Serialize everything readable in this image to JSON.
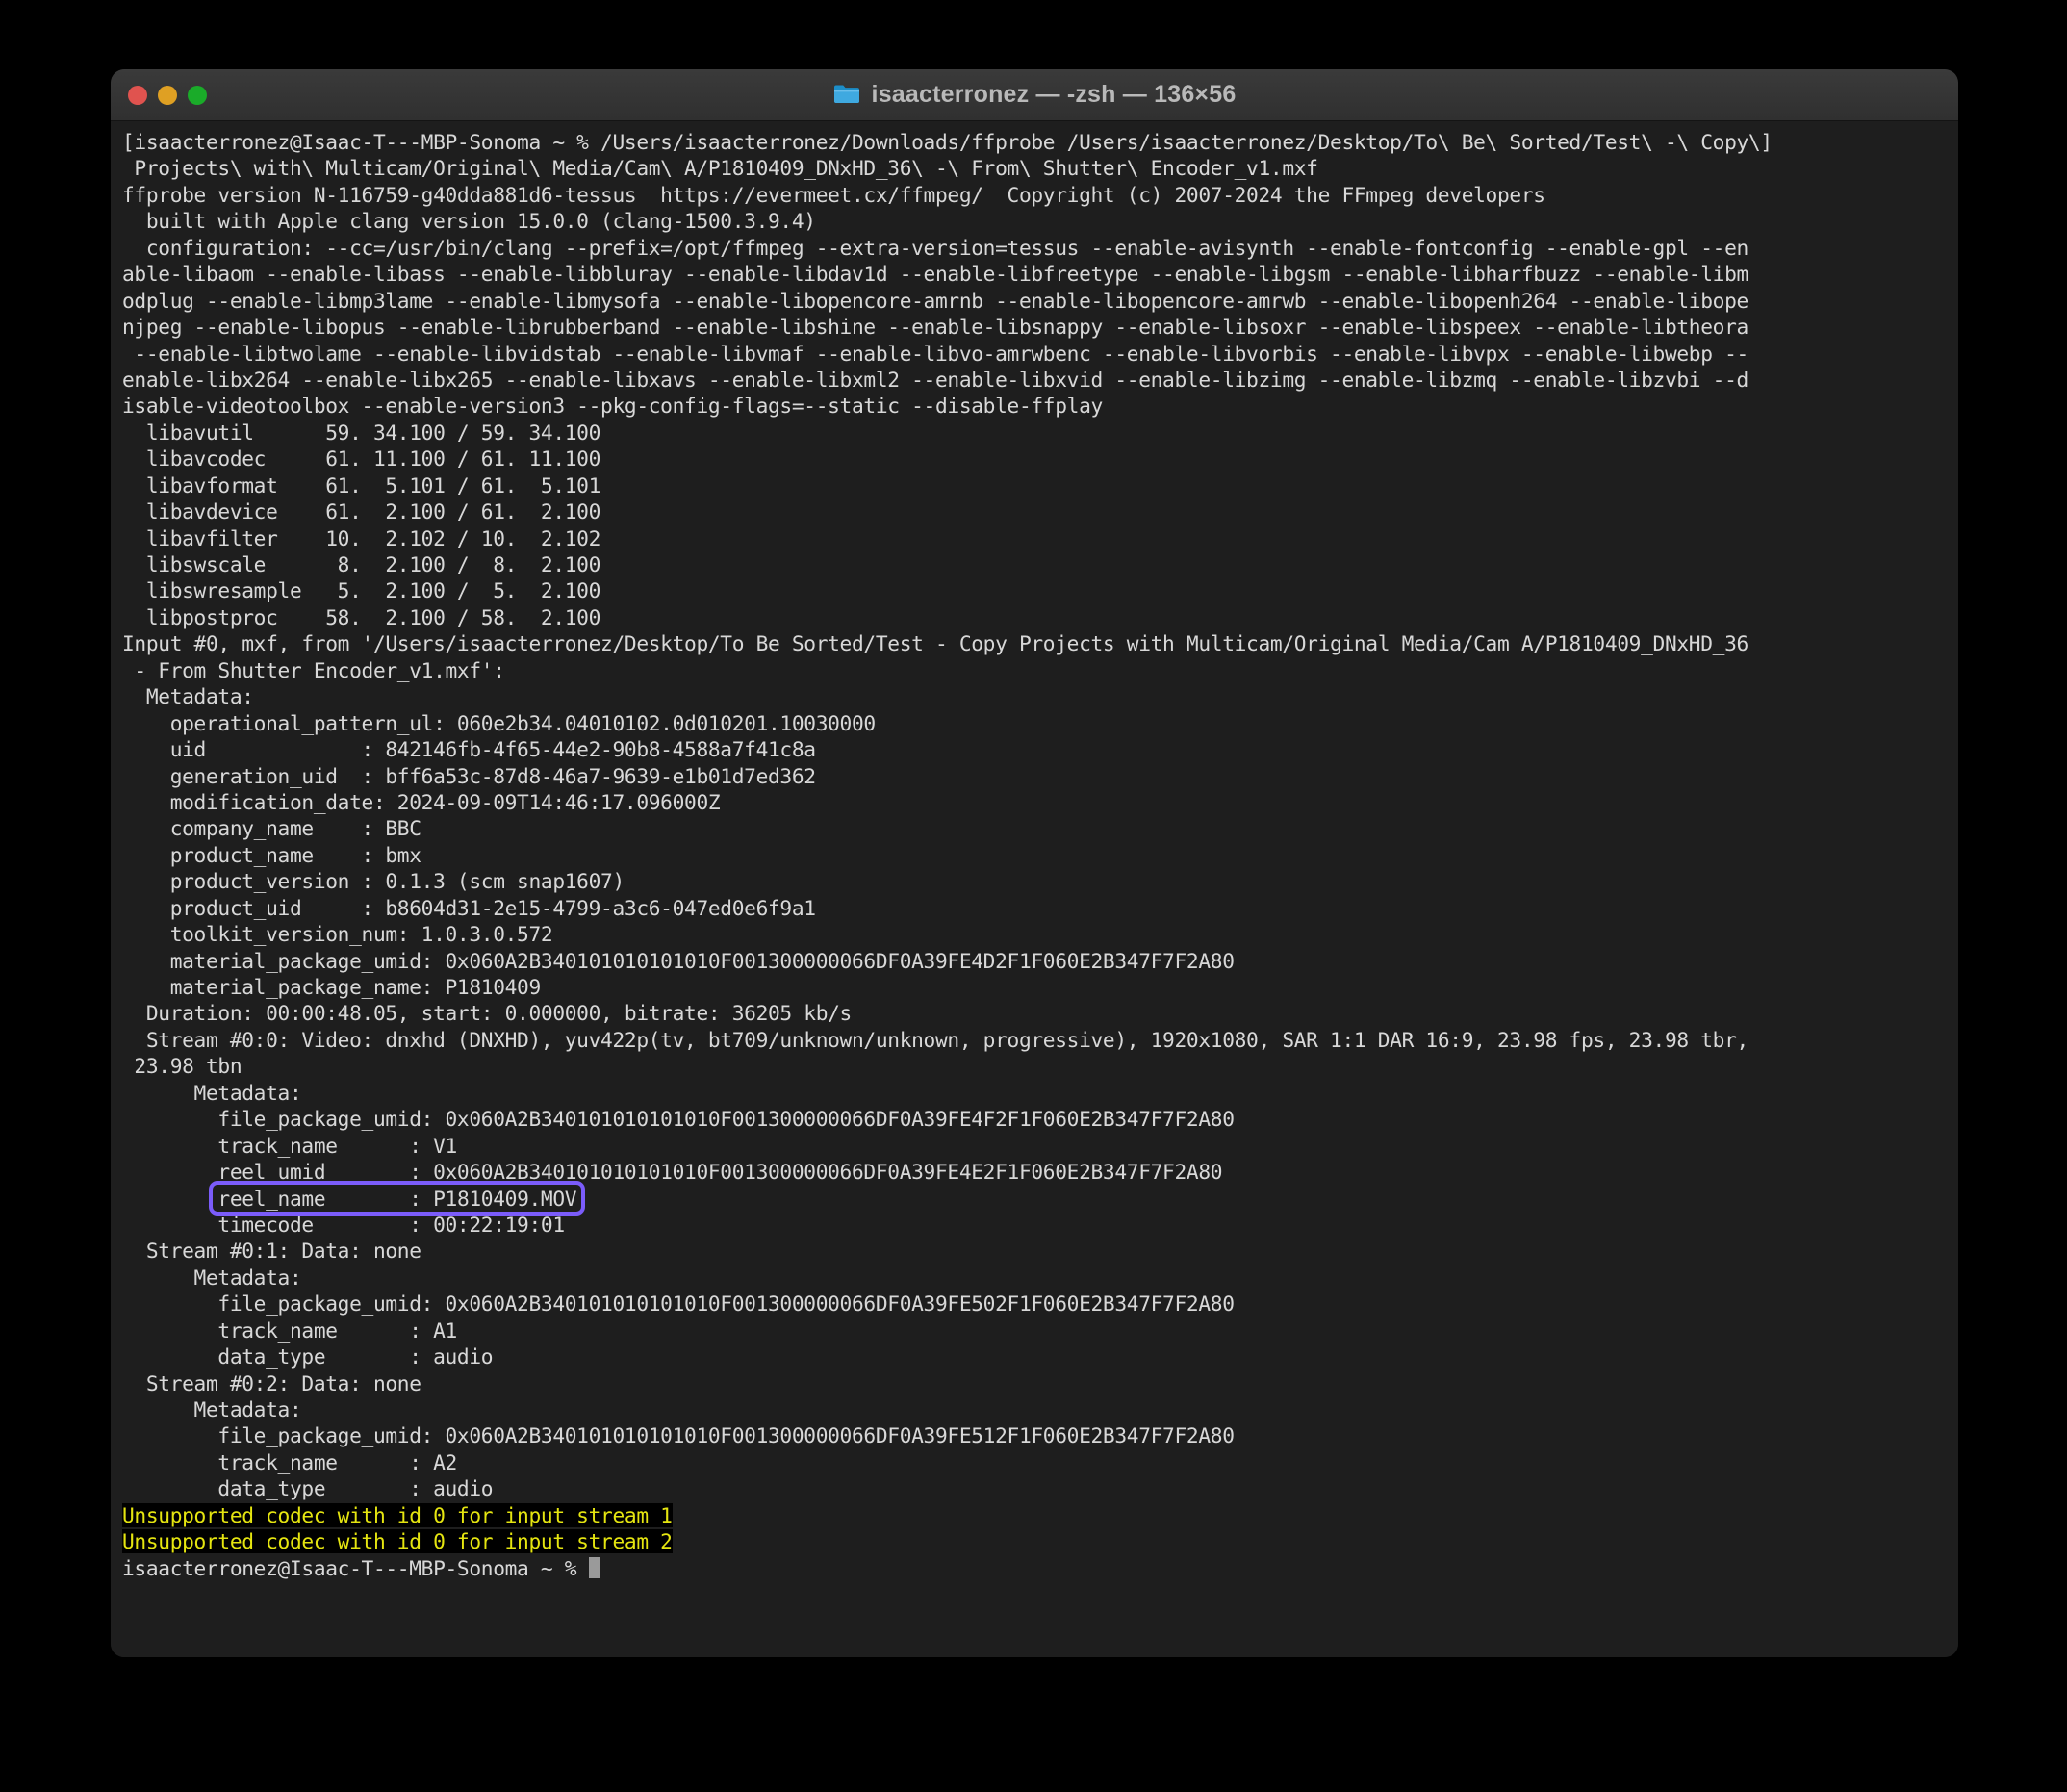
{
  "window": {
    "title": "isaacterronez — -zsh — 136×56",
    "folder_icon": "folder-icon",
    "traffic_lights": {
      "close": "close-button",
      "minimize": "minimize-button",
      "maximize": "maximize-button"
    },
    "colors": {
      "background": "#1e1e1e",
      "titlebar": "#343434",
      "text": "#d8d8d8",
      "warning": "#e5e510",
      "highlight": "#7b5cfa",
      "close": "#e0534f",
      "minimize": "#dfa023",
      "maximize": "#1aab29"
    }
  },
  "terminal": {
    "prompt_head": "isaacterronez@Isaac-T---MBP-Sonoma ~ % ",
    "lines": [
      "[isaacterronez@Isaac-T---MBP-Sonoma ~ % /Users/isaacterronez/Downloads/ffprobe /Users/isaacterronez/Desktop/To\\ Be\\ Sorted/Test\\ -\\ Copy\\]",
      " Projects\\ with\\ Multicam/Original\\ Media/Cam\\ A/P1810409_DNxHD_36\\ -\\ From\\ Shutter\\ Encoder_v1.mxf",
      "ffprobe version N-116759-g40dda881d6-tessus  https://evermeet.cx/ffmpeg/  Copyright (c) 2007-2024 the FFmpeg developers",
      "  built with Apple clang version 15.0.0 (clang-1500.3.9.4)",
      "  configuration: --cc=/usr/bin/clang --prefix=/opt/ffmpeg --extra-version=tessus --enable-avisynth --enable-fontconfig --enable-gpl --en",
      "able-libaom --enable-libass --enable-libbluray --enable-libdav1d --enable-libfreetype --enable-libgsm --enable-libharfbuzz --enable-libm",
      "odplug --enable-libmp3lame --enable-libmysofa --enable-libopencore-amrnb --enable-libopencore-amrwb --enable-libopenh264 --enable-libope",
      "njpeg --enable-libopus --enable-librubberband --enable-libshine --enable-libsnappy --enable-libsoxr --enable-libspeex --enable-libtheora",
      " --enable-libtwolame --enable-libvidstab --enable-libvmaf --enable-libvo-amrwbenc --enable-libvorbis --enable-libvpx --enable-libwebp --",
      "enable-libx264 --enable-libx265 --enable-libxavs --enable-libxml2 --enable-libxvid --enable-libzimg --enable-libzmq --enable-libzvbi --d",
      "isable-videotoolbox --enable-version3 --pkg-config-flags=--static --disable-ffplay",
      "  libavutil      59. 34.100 / 59. 34.100",
      "  libavcodec     61. 11.100 / 61. 11.100",
      "  libavformat    61.  5.101 / 61.  5.101",
      "  libavdevice    61.  2.100 / 61.  2.100",
      "  libavfilter    10.  2.102 / 10.  2.102",
      "  libswscale      8.  2.100 /  8.  2.100",
      "  libswresample   5.  2.100 /  5.  2.100",
      "  libpostproc    58.  2.100 / 58.  2.100",
      "Input #0, mxf, from '/Users/isaacterronez/Desktop/To Be Sorted/Test - Copy Projects with Multicam/Original Media/Cam A/P1810409_DNxHD_36",
      " - From Shutter Encoder_v1.mxf':",
      "  Metadata:",
      "    operational_pattern_ul: 060e2b34.04010102.0d010201.10030000",
      "    uid             : 842146fb-4f65-44e2-90b8-4588a7f41c8a",
      "    generation_uid  : bff6a53c-87d8-46a7-9639-e1b01d7ed362",
      "    modification_date: 2024-09-09T14:46:17.096000Z",
      "    company_name    : BBC",
      "    product_name    : bmx",
      "    product_version : 0.1.3 (scm snap1607)",
      "    product_uid     : b8604d31-2e15-4799-a3c6-047ed0e6f9a1",
      "    toolkit_version_num: 1.0.3.0.572",
      "    material_package_umid: 0x060A2B340101010101010F001300000066DF0A39FE4D2F1F060E2B347F7F2A80",
      "    material_package_name: P1810409",
      "  Duration: 00:00:48.05, start: 0.000000, bitrate: 36205 kb/s",
      "  Stream #0:0: Video: dnxhd (DNXHD), yuv422p(tv, bt709/unknown/unknown, progressive), 1920x1080, SAR 1:1 DAR 16:9, 23.98 fps, 23.98 tbr,",
      " 23.98 tbn",
      "      Metadata:",
      "        file_package_umid: 0x060A2B340101010101010F001300000066DF0A39FE4F2F1F060E2B347F7F2A80",
      "        track_name      : V1",
      "        reel_umid       : 0x060A2B340101010101010F001300000066DF0A39FE4E2F1F060E2B347F7F2A80",
      "        reel_name       : P1810409.MOV",
      "        timecode        : 00:22:19:01",
      "  Stream #0:1: Data: none",
      "      Metadata:",
      "        file_package_umid: 0x060A2B340101010101010F001300000066DF0A39FE502F1F060E2B347F7F2A80",
      "        track_name      : A1",
      "        data_type       : audio",
      "  Stream #0:2: Data: none",
      "      Metadata:",
      "        file_package_umid: 0x060A2B340101010101010F001300000066DF0A39FE512F1F060E2B347F7F2A80",
      "        track_name      : A2",
      "        data_type       : audio"
    ],
    "warnings": [
      "Unsupported codec with id 0 for input stream 1",
      "Unsupported codec with id 0 for input stream 2"
    ],
    "highlighted_line_index": 40,
    "highlighted_text": "reel_name       : P1810409.MOV",
    "final_prompt": "isaacterronez@Isaac-T---MBP-Sonoma ~ % ",
    "cursor": "block-cursor"
  }
}
